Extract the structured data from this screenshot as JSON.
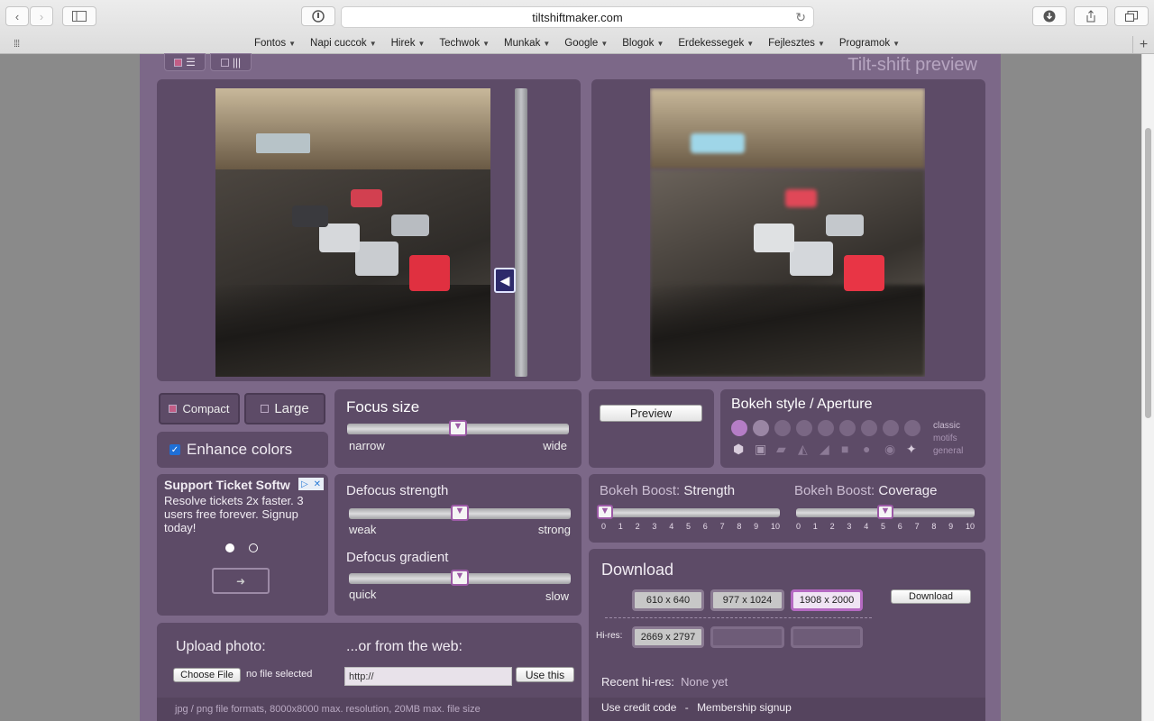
{
  "browser": {
    "url": "tiltshiftmaker.com",
    "bookmarks": [
      "Fontos",
      "Napi cuccok",
      "Hirek",
      "Techwok",
      "Munkak",
      "Google",
      "Blogok",
      "Erdekessegek",
      "Fejlesztes",
      "Programok"
    ]
  },
  "header": {
    "preview_title": "Tilt-shift preview"
  },
  "view_toggle": {
    "selected": "list"
  },
  "slider_vertical": {
    "focus_position": 0.66
  },
  "layout_buttons": {
    "compact": "Compact",
    "large": "Large"
  },
  "enhance": {
    "label": "Enhance colors",
    "checked": true
  },
  "focus_size": {
    "title": "Focus size",
    "min_label": "narrow",
    "max_label": "wide",
    "value": 0.5
  },
  "preview_button": "Preview",
  "bokeh_style": {
    "title": "Bokeh style / Aperture",
    "categories": [
      "classic",
      "motifs",
      "general"
    ]
  },
  "ad": {
    "title": "Support Ticket Softw",
    "body": "Resolve tickets 2x faster. 3 users free forever. Signup today!"
  },
  "defocus_strength": {
    "title": "Defocus strength",
    "min_label": "weak",
    "max_label": "strong",
    "value": 0.5
  },
  "defocus_gradient": {
    "title": "Defocus gradient",
    "min_label": "quick",
    "max_label": "slow",
    "value": 0.5
  },
  "bokeh_strength": {
    "title_prefix": "Bokeh Boost:",
    "title": "Strength",
    "ticks": [
      "0",
      "1",
      "2",
      "3",
      "4",
      "5",
      "6",
      "7",
      "8",
      "9",
      "10"
    ],
    "value": 0
  },
  "bokeh_coverage": {
    "title_prefix": "Bokeh Boost:",
    "title": "Coverage",
    "ticks": [
      "0",
      "1",
      "2",
      "3",
      "4",
      "5",
      "6",
      "7",
      "8",
      "9",
      "10"
    ],
    "value": 5
  },
  "download": {
    "title": "Download",
    "sizes": [
      "610 x 640",
      "977 x 1024",
      "1908 x 2000"
    ],
    "selected_size": "1908 x 2000",
    "button": "Download",
    "hires_label": "Hi-res:",
    "hires_size": "2669 x 2797",
    "recent_label": "Recent hi-res:",
    "recent_value": "None yet",
    "credit_link": "Use credit code",
    "separator": "-",
    "membership_link": "Membership signup"
  },
  "upload": {
    "title": "Upload photo:",
    "choose_button": "Choose File",
    "no_file": "no file selected",
    "web_title": "...or from the web:",
    "url_value": "http://",
    "use_button": "Use this",
    "footer": "jpg / png file formats, 8000x8000 max. resolution, 20MB max. file size"
  },
  "icons": {
    "back": "chevron-left-icon",
    "forward": "chevron-right-icon",
    "sidebar": "sidebar-icon",
    "reader": "reader-icon",
    "reload": "reload-icon",
    "download": "download-icon",
    "share": "share-icon",
    "tabs": "tabs-icon"
  }
}
